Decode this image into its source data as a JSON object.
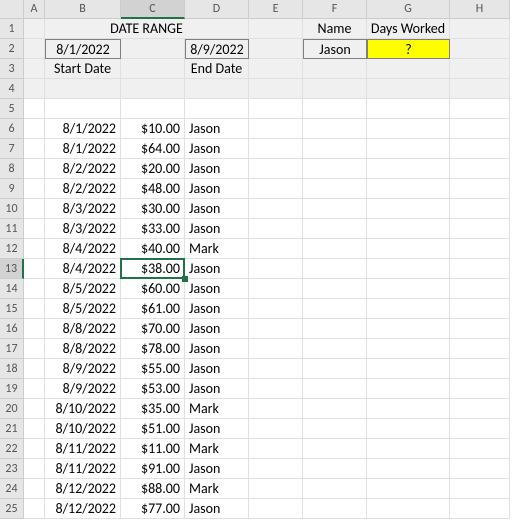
{
  "colHeaders": [
    "A",
    "B",
    "C",
    "D",
    "E",
    "F",
    "G",
    "H"
  ],
  "rowHeaders": [
    "1",
    "2",
    "3",
    "4",
    "5",
    "6",
    "7",
    "8",
    "9",
    "10",
    "11",
    "12",
    "13",
    "14",
    "15",
    "16",
    "17",
    "18",
    "19",
    "20",
    "21",
    "22",
    "23",
    "24",
    "25"
  ],
  "header": {
    "dateRangeLabel": "DATE RANGE",
    "startDate": "8/1/2022",
    "endDate": "8/9/2022",
    "startDateLabel": "Start Date",
    "endDateLabel": "End Date",
    "nameHeader": "Name",
    "daysWorkedHeader": "Days Worked",
    "nameValue": "Jason",
    "daysWorkedValue": "?"
  },
  "rows": [
    {
      "date": "8/1/2022",
      "amt": "$10.00",
      "name": "Jason"
    },
    {
      "date": "8/1/2022",
      "amt": "$64.00",
      "name": "Jason"
    },
    {
      "date": "8/2/2022",
      "amt": "$20.00",
      "name": "Jason"
    },
    {
      "date": "8/2/2022",
      "amt": "$48.00",
      "name": "Jason"
    },
    {
      "date": "8/3/2022",
      "amt": "$30.00",
      "name": "Jason"
    },
    {
      "date": "8/3/2022",
      "amt": "$33.00",
      "name": "Jason"
    },
    {
      "date": "8/4/2022",
      "amt": "$40.00",
      "name": "Mark"
    },
    {
      "date": "8/4/2022",
      "amt": "$38.00",
      "name": "Jason"
    },
    {
      "date": "8/5/2022",
      "amt": "$60.00",
      "name": "Jason"
    },
    {
      "date": "8/5/2022",
      "amt": "$61.00",
      "name": "Jason"
    },
    {
      "date": "8/8/2022",
      "amt": "$70.00",
      "name": "Jason"
    },
    {
      "date": "8/8/2022",
      "amt": "$78.00",
      "name": "Jason"
    },
    {
      "date": "8/9/2022",
      "amt": "$55.00",
      "name": "Jason"
    },
    {
      "date": "8/9/2022",
      "amt": "$53.00",
      "name": "Jason"
    },
    {
      "date": "8/10/2022",
      "amt": "$35.00",
      "name": "Mark"
    },
    {
      "date": "8/10/2022",
      "amt": "$51.00",
      "name": "Jason"
    },
    {
      "date": "8/11/2022",
      "amt": "$11.00",
      "name": "Mark"
    },
    {
      "date": "8/11/2022",
      "amt": "$91.00",
      "name": "Jason"
    },
    {
      "date": "8/12/2022",
      "amt": "$88.00",
      "name": "Mark"
    },
    {
      "date": "8/12/2022",
      "amt": "$77.00",
      "name": "Jason"
    }
  ]
}
